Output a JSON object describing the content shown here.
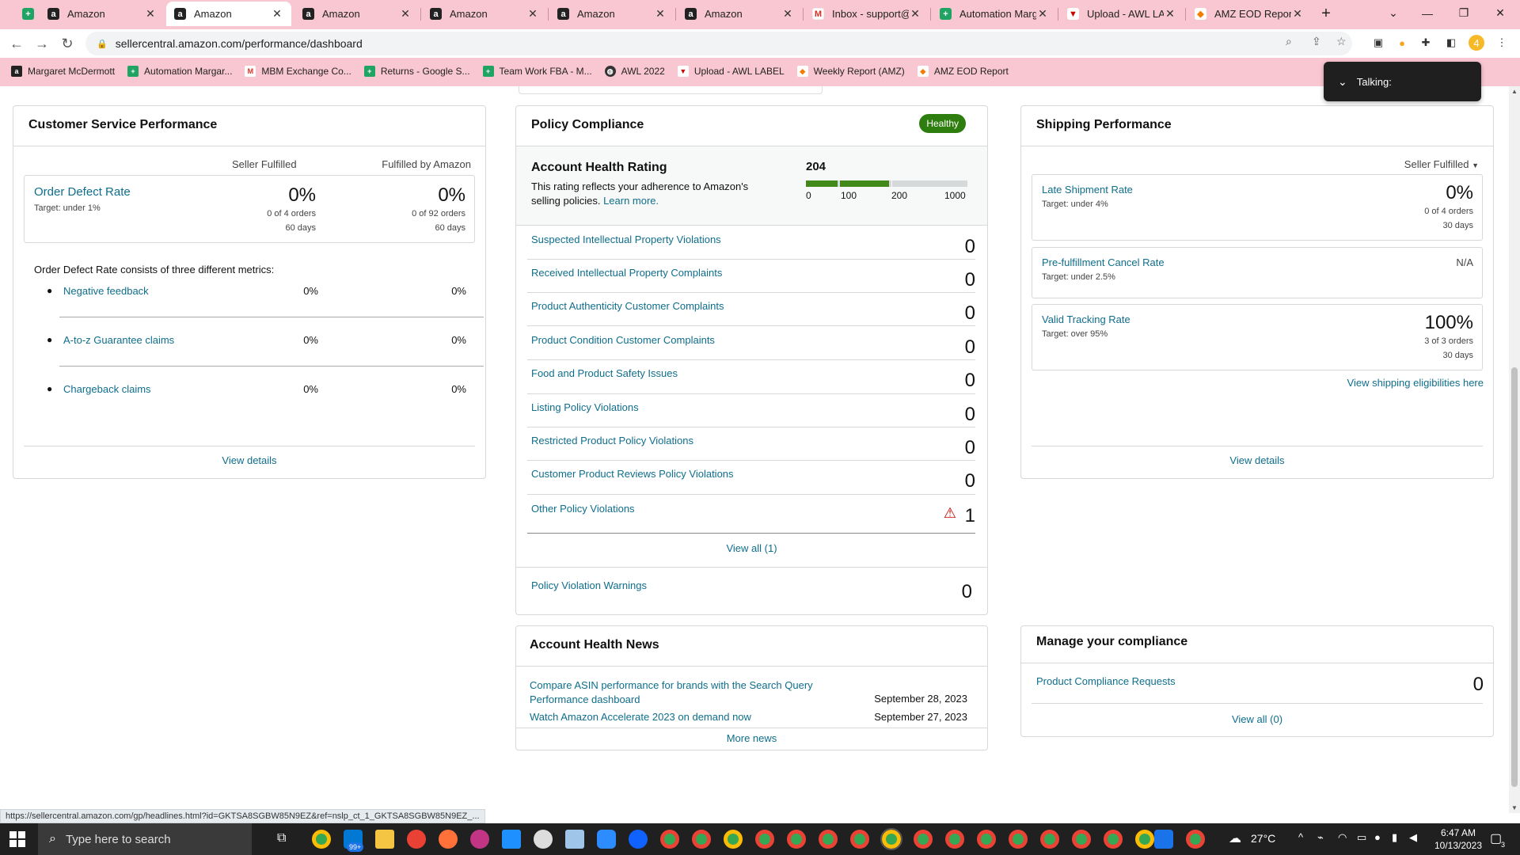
{
  "browser": {
    "tabs": [
      {
        "title": "",
        "icon": "sheets-icon"
      },
      {
        "title": "Amazon",
        "icon": "amazon-icon"
      },
      {
        "title": "Amazon",
        "icon": "amazon-icon"
      },
      {
        "title": "Amazon",
        "icon": "amazon-icon"
      },
      {
        "title": "Amazon",
        "icon": "amazon-icon"
      },
      {
        "title": "Amazon",
        "icon": "amazon-icon"
      },
      {
        "title": "Amazon",
        "icon": "amazon-icon"
      },
      {
        "title": "Inbox - support@",
        "icon": "gmail-icon"
      },
      {
        "title": "Automation Marg",
        "icon": "sheets-icon"
      },
      {
        "title": "Upload - AWL LA",
        "icon": "awl-icon"
      },
      {
        "title": "AMZ EOD Report",
        "icon": "eod-icon"
      }
    ],
    "new_tab": "+",
    "url": "sellercentral.amazon.com/performance/dashboard",
    "bookmarks": [
      {
        "label": "Margaret McDermott",
        "icon": "amazon-icon"
      },
      {
        "label": "Automation Margar...",
        "icon": "sheets-icon"
      },
      {
        "label": "MBM Exchange Co...",
        "icon": "gmail-icon"
      },
      {
        "label": "Returns - Google S...",
        "icon": "sheets-icon"
      },
      {
        "label": "Team Work FBA - M...",
        "icon": "sheets-icon"
      },
      {
        "label": "AWL 2022",
        "icon": "globe-icon"
      },
      {
        "label": "Upload - AWL LABEL",
        "icon": "awl-icon"
      },
      {
        "label": "Weekly Report (AMZ)",
        "icon": "eod-icon"
      },
      {
        "label": "AMZ EOD Report",
        "icon": "eod-icon"
      }
    ],
    "talking": "Talking:",
    "status_url": "https://sellercentral.amazon.com/gp/headlines.html?id=GKTSA8SGBW85N9EZ&ref=nslp_ct_1_GKTSA8SGBW85N9EZ_..."
  },
  "customer_service": {
    "title": "Customer Service Performance",
    "col_seller": "Seller Fulfilled",
    "col_fba": "Fulfilled by Amazon",
    "odr_label": "Order Defect Rate",
    "odr_target": "Target: under 1%",
    "odr_seller_value": "0%",
    "odr_seller_orders": "0 of 4 orders",
    "odr_seller_days": "60 days",
    "odr_fba_value": "0%",
    "odr_fba_orders": "0 of 92 orders",
    "odr_fba_days": "60 days",
    "consists_text": "Order Defect Rate consists of three different metrics:",
    "metrics": [
      {
        "label": "Negative feedback",
        "seller": "0%",
        "fba": "0%"
      },
      {
        "label": "A-to-z Guarantee claims",
        "seller": "0%",
        "fba": "0%"
      },
      {
        "label": "Chargeback claims",
        "seller": "0%",
        "fba": "0%"
      }
    ],
    "view_details": "View details"
  },
  "policy": {
    "title": "Policy Compliance",
    "status": "Healthy",
    "ahr_title": "Account Health Rating",
    "ahr_value": "204",
    "ahr_desc": "This rating reflects your adherence to Amazon's selling policies.",
    "learn_more": "Learn more.",
    "scale": [
      "0",
      "100",
      "200",
      "1000"
    ],
    "rows": [
      {
        "label": "Suspected Intellectual Property Violations",
        "value": "0"
      },
      {
        "label": "Received Intellectual Property Complaints",
        "value": "0"
      },
      {
        "label": "Product Authenticity Customer Complaints",
        "value": "0"
      },
      {
        "label": "Product Condition Customer Complaints",
        "value": "0"
      },
      {
        "label": "Food and Product Safety Issues",
        "value": "0"
      },
      {
        "label": "Listing Policy Violations",
        "value": "0"
      },
      {
        "label": "Restricted Product Policy Violations",
        "value": "0"
      },
      {
        "label": "Customer Product Reviews Policy Violations",
        "value": "0"
      },
      {
        "label": "Other Policy Violations",
        "value": "1"
      }
    ],
    "view_all": "View all (1)",
    "warnings_label": "Policy Violation Warnings",
    "warnings_value": "0"
  },
  "news": {
    "title": "Account Health News",
    "items": [
      {
        "title": "Compare ASIN performance for brands with the Search Query Performance dashboard",
        "date": "September 28, 2023"
      },
      {
        "title": "Watch Amazon Accelerate 2023 on demand now",
        "date": "September 27, 2023"
      }
    ],
    "more": "More news"
  },
  "shipping": {
    "title": "Shipping Performance",
    "filter": "Seller Fulfilled",
    "late_label": "Late Shipment Rate",
    "late_target": "Target: under 4%",
    "late_value": "0%",
    "late_orders": "0 of 4 orders",
    "late_days": "30 days",
    "cancel_label": "Pre-fulfillment Cancel Rate",
    "cancel_target": "Target: under 2.5%",
    "cancel_value": "N/A",
    "vtr_label": "Valid Tracking Rate",
    "vtr_target": "Target: over 95%",
    "vtr_value": "100%",
    "vtr_orders": "3 of 3 orders",
    "vtr_days": "30 days",
    "eligibility": "View shipping eligibilities here",
    "view_details": "View details"
  },
  "compliance": {
    "title": "Manage your compliance",
    "requests_label": "Product Compliance Requests",
    "requests_value": "0",
    "view_all": "View all (0)"
  },
  "taskbar": {
    "search_placeholder": "Type here to search",
    "badge": "99+",
    "temp": "27°C",
    "time": "6:47 AM",
    "date": "10/13/2023",
    "notif_count": "3"
  },
  "colors": {
    "healthy": "#2e7d0f",
    "link": "#0f6e8c",
    "chrome_bg": "#f9c7d1"
  }
}
